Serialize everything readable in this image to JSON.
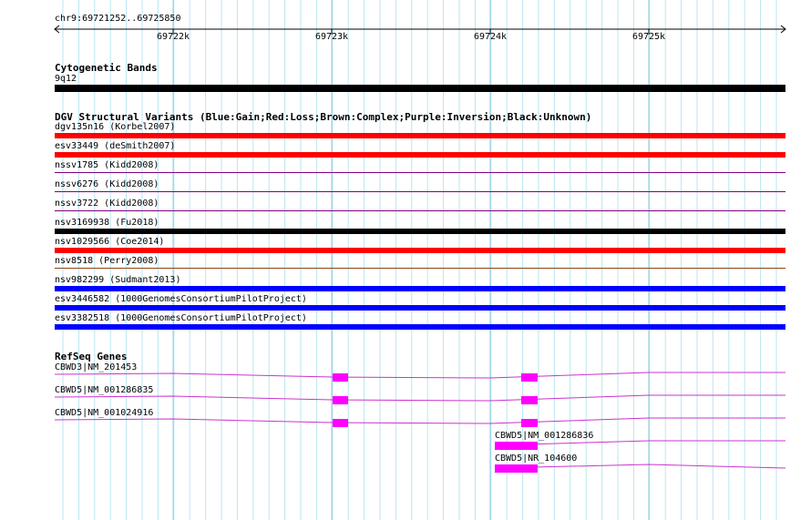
{
  "ruler": {
    "coords": "chr9:69721252..69725850",
    "ticks": [
      "69722k",
      "69723k",
      "69724k",
      "69725k"
    ]
  },
  "cytoband": {
    "title": "Cytogenetic Bands",
    "band": "9q12",
    "color": "#000000"
  },
  "dgv": {
    "title": "DGV Structural Variants (Blue:Gain;Red:Loss;Brown:Complex;Purple:Inversion;Black:Unknown)",
    "items": [
      {
        "label": "dgv135n16 (Korbel2007)",
        "color": "#ff0000",
        "style": "thick"
      },
      {
        "label": "esv33449 (deSmith2007)",
        "color": "#ff0000",
        "style": "thick"
      },
      {
        "label": "nssv1785 (Kidd2008)",
        "color": "#800080",
        "style": "thin"
      },
      {
        "label": "nssv6276 (Kidd2008)",
        "color": "#800080",
        "style": "thin"
      },
      {
        "label": "nssv3722 (Kidd2008)",
        "color": "#800080",
        "style": "thin"
      },
      {
        "label": "nsv3169938 (Fu2018)",
        "color": "#000000",
        "style": "thick"
      },
      {
        "label": "nsv1029566 (Coe2014)",
        "color": "#ff0000",
        "style": "thick"
      },
      {
        "label": "nsv8518 (Perry2008)",
        "color": "#8b4513",
        "style": "thin"
      },
      {
        "label": "nsv982299 (Sudmant2013)",
        "color": "#0000ff",
        "style": "thick"
      },
      {
        "label": "esv3446582 (1000GenomesConsortiumPilotProject)",
        "color": "#0000ff",
        "style": "thick"
      },
      {
        "label": "esv3382518 (1000GenomesConsortiumPilotProject)",
        "color": "#0000ff",
        "style": "thick"
      }
    ]
  },
  "refseq": {
    "title": "RefSeq Genes",
    "color": "#ff00ff",
    "genes": [
      {
        "label": "CBWD3|NM_201453"
      },
      {
        "label": "CBWD5|NM_001286835"
      },
      {
        "label": "CBWD5|NM_001024916"
      },
      {
        "label": "CBWD5|NM_001286836"
      },
      {
        "label": "CBWD5|NR_104600"
      }
    ]
  }
}
